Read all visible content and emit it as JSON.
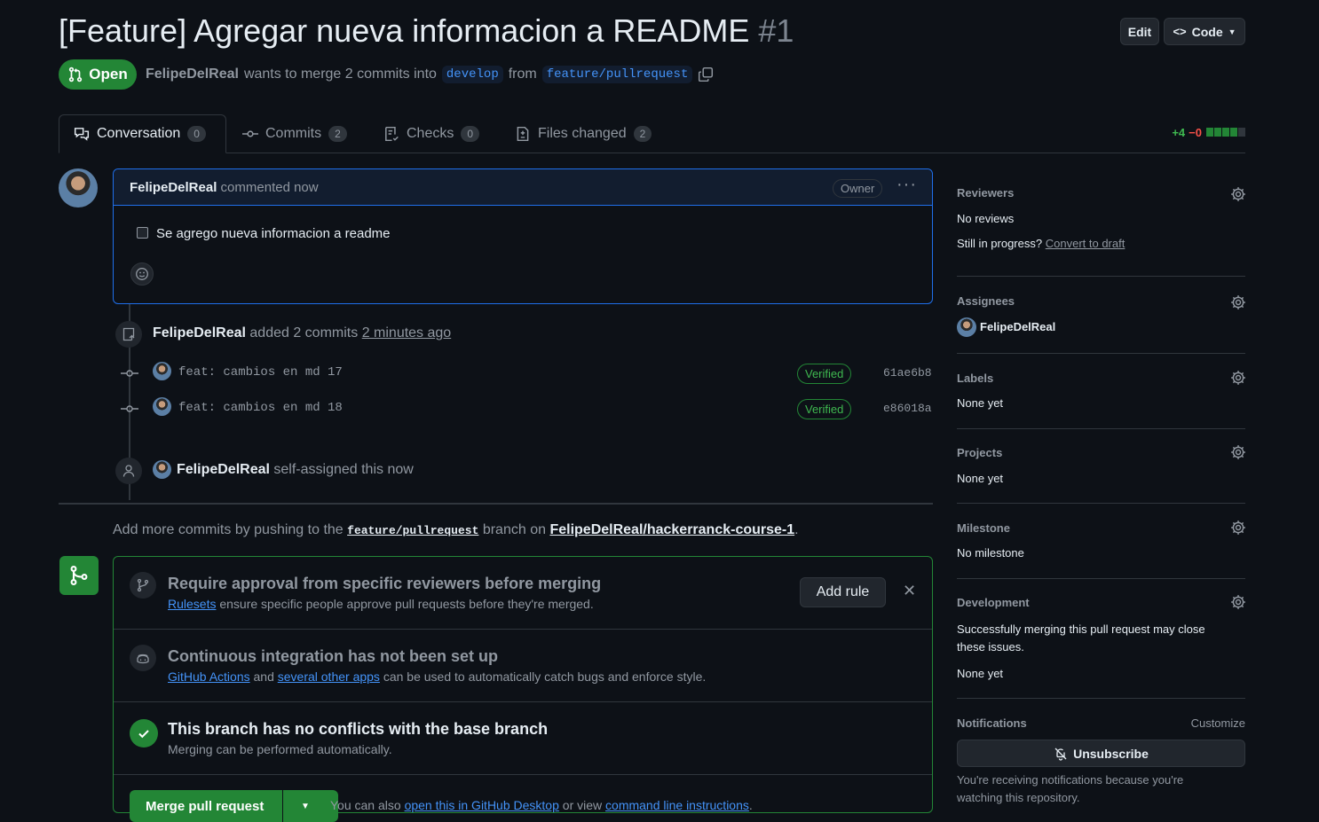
{
  "header": {
    "title": "[Feature] Agregar nueva informacion a README",
    "number": "#1",
    "edit_label": "Edit",
    "code_label": "Code"
  },
  "pr": {
    "state": "Open",
    "author": "FelipeDelReal",
    "merge_text": "wants to merge 2 commits into",
    "base": "develop",
    "from_word": "from",
    "head": "feature/pullrequest"
  },
  "tabs": [
    {
      "label": "Conversation",
      "count": "0"
    },
    {
      "label": "Commits",
      "count": "2"
    },
    {
      "label": "Checks",
      "count": "0"
    },
    {
      "label": "Files changed",
      "count": "2"
    }
  ],
  "diffstat": {
    "added": "+4",
    "removed": "−0"
  },
  "comment": {
    "author": "FelipeDelReal",
    "action": "commented now",
    "badge": "Owner",
    "task": "Se agrego nueva informacion a readme"
  },
  "timeline": {
    "commits_event": {
      "author": "FelipeDelReal",
      "text": "added 2 commits",
      "time": "2 minutes ago"
    },
    "commits": [
      {
        "message": "feat: cambios en md 17",
        "badge": "Verified",
        "sha": "61ae6b8"
      },
      {
        "message": "feat: cambios en md 18",
        "badge": "Verified",
        "sha": "e86018a"
      }
    ],
    "assign_event": {
      "author": "FelipeDelReal",
      "text": "self-assigned this now"
    }
  },
  "push_hint": {
    "prefix": "Add more commits by pushing to the",
    "branch": "feature/pullrequest",
    "middle": "branch on",
    "repo": "FelipeDelReal/hackerranck-course-1",
    "suffix": "."
  },
  "merge": {
    "rules": {
      "title": "Require approval from specific reviewers before merging",
      "link": "Rulesets",
      "text": "ensure specific people approve pull requests before they're merged.",
      "button": "Add rule"
    },
    "ci": {
      "title": "Continuous integration has not been set up",
      "link1": "GitHub Actions",
      "and": "and",
      "link2": "several other apps",
      "text": "can be used to automatically catch bugs and enforce style."
    },
    "conflicts": {
      "title": "This branch has no conflicts with the base branch",
      "text": "Merging can be performed automatically."
    },
    "actions": {
      "button": "Merge pull request",
      "also": "You can also",
      "link1": "open this in GitHub Desktop",
      "or": "or view",
      "link2": "command line instructions",
      "end": "."
    }
  },
  "sidebar": {
    "reviewers": {
      "heading": "Reviewers",
      "value": "No reviews",
      "progress": "Still in progress?",
      "draft_link": "Convert to draft"
    },
    "assignees": {
      "heading": "Assignees",
      "value": "FelipeDelReal"
    },
    "labels": {
      "heading": "Labels",
      "value": "None yet"
    },
    "projects": {
      "heading": "Projects",
      "value": "None yet"
    },
    "milestone": {
      "heading": "Milestone",
      "value": "No milestone"
    },
    "development": {
      "heading": "Development",
      "text": "Successfully merging this pull request may close these issues.",
      "value": "None yet"
    },
    "notifications": {
      "heading": "Notifications",
      "customize": "Customize",
      "button": "Unsubscribe",
      "text": "You're receiving notifications because you're watching this repository."
    }
  },
  "colors": {
    "accent": "#4493f8",
    "success": "#238636",
    "danger": "#f85149",
    "bg": "#0d1117"
  }
}
